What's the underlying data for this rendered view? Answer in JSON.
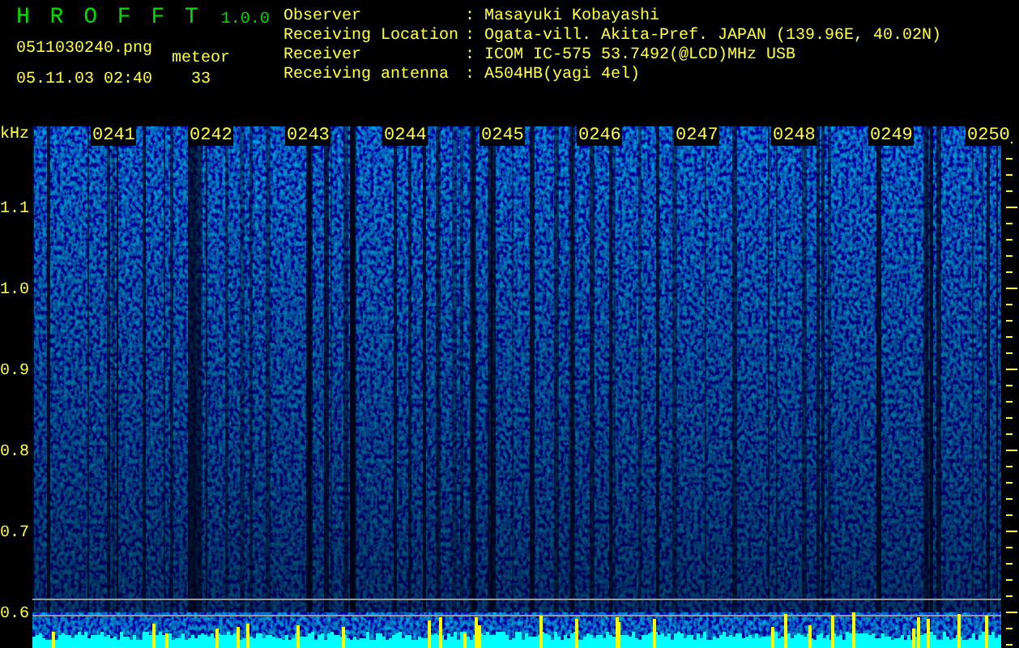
{
  "app": {
    "title": "H R O F F T",
    "version": "1.0.0",
    "filename": "0511030240.png",
    "datetime": "05.11.03 02:40",
    "meteor_label": "meteor",
    "meteor_count": "33"
  },
  "info": [
    {
      "label": "Observer",
      "separator": ":",
      "value": "Masayuki Kobayashi"
    },
    {
      "label": "Receiving Location",
      "separator": ":",
      "value": "Ogata-vill. Akita-Pref. JAPAN (139.96E, 40.02N)"
    },
    {
      "label": "Receiver",
      "separator": ":",
      "value": "ICOM IC-575 53.7492(@LCD)MHz USB"
    },
    {
      "label": "Receiving antenna",
      "separator": ":",
      "value": "A504HB(yagi 4el)"
    }
  ],
  "spectrogram": {
    "unit": "kHz",
    "y_labels": [
      "1.1",
      "1.0",
      "0.9",
      "0.8",
      "0.7",
      "0.6"
    ],
    "time_labels": [
      "0241",
      "0242",
      "0243",
      "0244",
      "0245",
      "0246",
      "0247",
      "0248",
      "0249",
      "0250"
    ]
  }
}
